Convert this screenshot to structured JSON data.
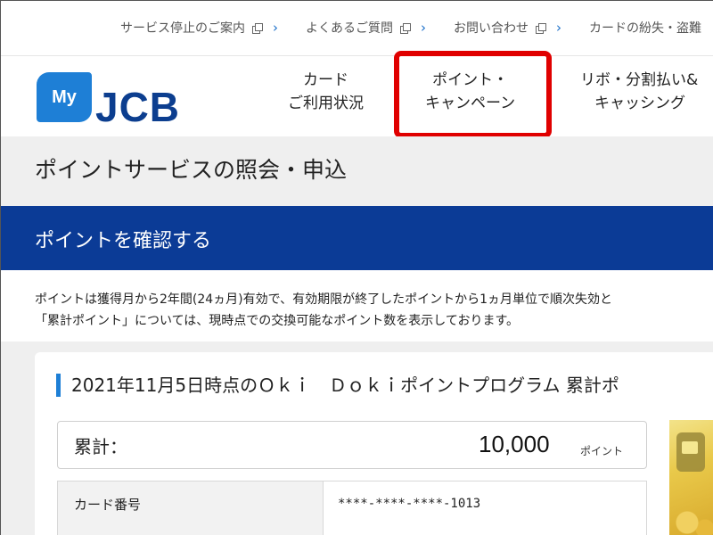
{
  "utility_links": [
    {
      "label": "サービス停止のご案内"
    },
    {
      "label": "よくあるご質問"
    },
    {
      "label": "お問い合わせ"
    },
    {
      "label": "カードの紛失・盗難"
    }
  ],
  "logo": {
    "my": "My",
    "brand": "JCB"
  },
  "nav": {
    "card_usage": {
      "line1": "カード",
      "line2": "ご利用状況"
    },
    "points": {
      "line1": "ポイント・",
      "line2": "キャンペーン"
    },
    "revolving": {
      "line1": "リボ・分割払い&",
      "line2": "キャッシング"
    }
  },
  "page_title": "ポイントサービスの照会・申込",
  "section_title": "ポイントを確認する",
  "notice": {
    "line1": "ポイントは獲得月から2年間(24ヵ月)有効で、有効期限が終了したポイントから1ヵ月単位で順次失効と",
    "line2": "「累計ポイント」については、現時点での交換可能なポイント数を表示しております。"
  },
  "panel": {
    "title": "2021年11月5日時点のＯｋｉ　Ｄｏｋｉポイントプログラム 累計ポ",
    "total_label": "累計：",
    "total_value": "10,000",
    "total_unit": "ポイント",
    "card_number_label": "カード番号",
    "card_number_value": "****-****-****-1013"
  },
  "colors": {
    "brand_blue": "#0b3b96",
    "logo_blue": "#1e7fd6",
    "highlight_red": "#e00000"
  }
}
